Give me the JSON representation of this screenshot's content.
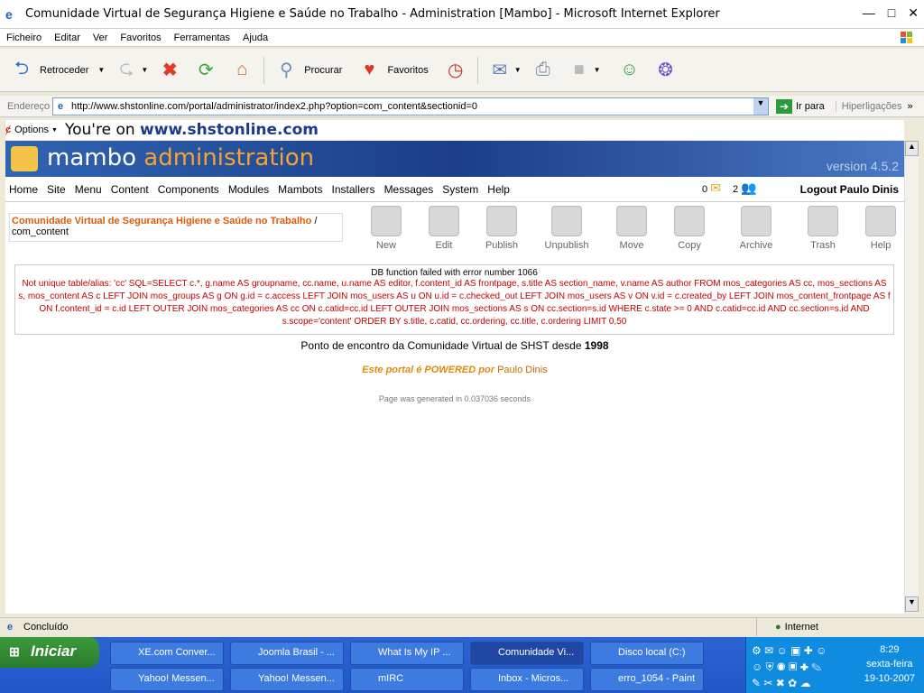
{
  "window": {
    "title": "Comunidade Virtual de Segurança Higiene e Saúde no Trabalho - Administration [Mambo] - Microsoft Internet Explorer"
  },
  "menubar": [
    "Ficheiro",
    "Editar",
    "Ver",
    "Favoritos",
    "Ferramentas",
    "Ajuda"
  ],
  "toolbar": {
    "back_label": "Retroceder",
    "search_label": "Procurar",
    "favorites_label": "Favoritos"
  },
  "address": {
    "label": "Endereço",
    "url": "http://www.shstonline.com/portal/administrator/index2.php?option=com_content&sectionid=0",
    "go_label": "Ir para",
    "links_label": "Hiperligações"
  },
  "options_bar": {
    "options_label": "Options",
    "youre_on": "You're on",
    "site": "www.shstonline.com"
  },
  "mambo": {
    "logo_main": "mambo",
    "logo_accent": "administration",
    "version": "version 4.5.2",
    "menu": [
      "Home",
      "Site",
      "Menu",
      "Content",
      "Components",
      "Modules",
      "Mambots",
      "Installers",
      "Messages",
      "System",
      "Help"
    ],
    "messages_count": "0",
    "users_count": "2",
    "logout": "Logout Paulo Dinis",
    "path_title": "Comunidade Virtual de Segurança Higiene e Saúde no Trabalho",
    "path_sep": " /",
    "path_sub": "com_content",
    "tools": [
      "New",
      "Edit",
      "Publish",
      "Unpublish",
      "Move",
      "Copy",
      "Archive",
      "Trash",
      "Help"
    ]
  },
  "error": {
    "heading": "DB function failed with error number 1066",
    "body": "Not unique table/alias: 'cc' SQL=SELECT c.*, g.name AS groupname, cc.name, u.name AS editor, f.content_id AS frontpage, s.title AS section_name, v.name AS author FROM mos_categories AS cc, mos_sections AS s, mos_content AS c LEFT JOIN mos_groups AS g ON g.id = c.access LEFT JOIN mos_users AS u ON u.id = c.checked_out LEFT JOIN mos_users AS v ON v.id = c.created_by LEFT JOIN mos_content_frontpage AS f ON f.content_id = c.id LEFT OUTER JOIN mos_categories AS cc ON c.catid=cc.id LEFT OUTER JOIN mos_sections AS s ON cc.section=s.id WHERE c.state >= 0 AND c.catid=cc.id AND cc.section=s.id AND s.scope='content' ORDER BY s.title, c.catid, cc.ordering, cc.title, c.ordering LIMIT 0,50"
  },
  "footer": {
    "line1_prefix": "Ponto de encontro da Comunidade Virtual de SHST desde",
    "line1_year": "1998",
    "powered": "Este portal é POWERED por",
    "powered_name": "Paulo Dinis",
    "generated": "Page was generated in 0.037036 seconds"
  },
  "status": {
    "text": "Concluído",
    "zone": "Internet"
  },
  "taskbar": {
    "start": "Iniciar",
    "row1": [
      "XE.com Conver...",
      "Joomla Brasil - ...",
      "What Is My IP ...",
      "Comunidade Vi...",
      "Disco local (C:)"
    ],
    "row2": [
      "Yahoo! Messen...",
      "Yahoo! Messen...",
      "mIRC",
      "Inbox - Micros...",
      "erro_1054 - Paint"
    ],
    "clock_time": "8:29",
    "clock_day": "sexta-feira",
    "clock_date": "19-10-2007"
  }
}
